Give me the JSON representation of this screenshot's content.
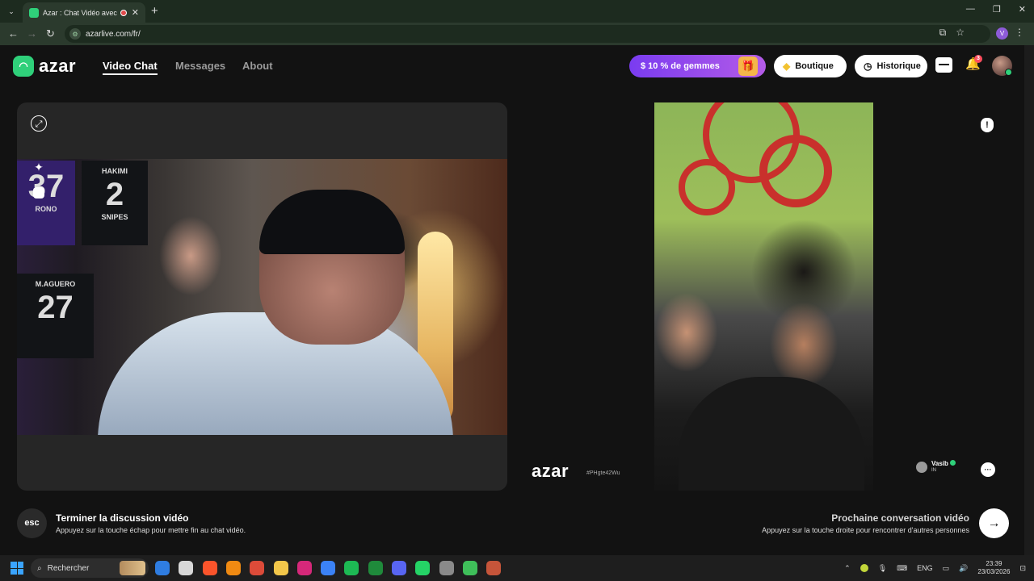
{
  "browser": {
    "tab_title": "Azar : Chat Vidéo avec de n",
    "tab_close": "✕",
    "new_tab": "+",
    "url": "azarlive.com/fr/",
    "tab_list": "⌄",
    "profile_initial": "V",
    "window_controls": {
      "minimize": "—",
      "maximize": "❐",
      "close": "✕"
    },
    "nav": {
      "back": "←",
      "forward": "→",
      "reload": "↻"
    }
  },
  "header": {
    "logo_text": "azar",
    "nav": [
      {
        "label": "Video Chat",
        "active": true
      },
      {
        "label": "Messages",
        "active": false
      },
      {
        "label": "About",
        "active": false
      }
    ],
    "promo_label": "$ 10 % de gemmes",
    "boutique_label": "Boutique",
    "historique_label": "Historique",
    "notification_count": "3"
  },
  "self_view": {
    "jerseys": [
      {
        "top": "37",
        "name": "RONO"
      },
      {
        "top": "HAKIMI",
        "number": "2",
        "name": "SNIPES"
      },
      {
        "top": "M.AGUERO",
        "number": "27",
        "name": ""
      }
    ]
  },
  "partner_view": {
    "watermark": "azar",
    "watermark_id": "#PHgte42Wu",
    "user_name": "Vasib",
    "user_country": "IN"
  },
  "footer": {
    "esc_key": "esc",
    "end_title": "Terminer la discussion vidéo",
    "end_description": "Appuyez sur la touche échap pour mettre fin au chat vidéo.",
    "next_title": "Prochaine conversation vidéo",
    "next_description": "Appuyez sur la touche droite pour rencontrer d'autres personnes",
    "next_glyph": "→"
  },
  "taskbar": {
    "search_placeholder": "Rechercher",
    "language": "ENG",
    "time": "23:39",
    "date": "23/03/2026",
    "apps": [
      {
        "name": "defender",
        "color": "#2f7de1"
      },
      {
        "name": "files-app",
        "color": "#d8d8d8"
      },
      {
        "name": "brave",
        "color": "#fb542b"
      },
      {
        "name": "vlc",
        "color": "#f08a12"
      },
      {
        "name": "chrome",
        "color": "#dd4b39"
      },
      {
        "name": "file-explorer",
        "color": "#f3c74a"
      },
      {
        "name": "instagram",
        "color": "#d6287a"
      },
      {
        "name": "store",
        "color": "#3b82f6"
      },
      {
        "name": "spotify",
        "color": "#1db954"
      },
      {
        "name": "xbox",
        "color": "#1f8a3b"
      },
      {
        "name": "discord",
        "color": "#5865f2"
      },
      {
        "name": "whatsapp",
        "color": "#25d366"
      },
      {
        "name": "steam",
        "color": "#8a8a8a"
      },
      {
        "name": "media-player",
        "color": "#3fbf5a"
      },
      {
        "name": "chrome-profile",
        "color": "#c6553a"
      }
    ]
  }
}
